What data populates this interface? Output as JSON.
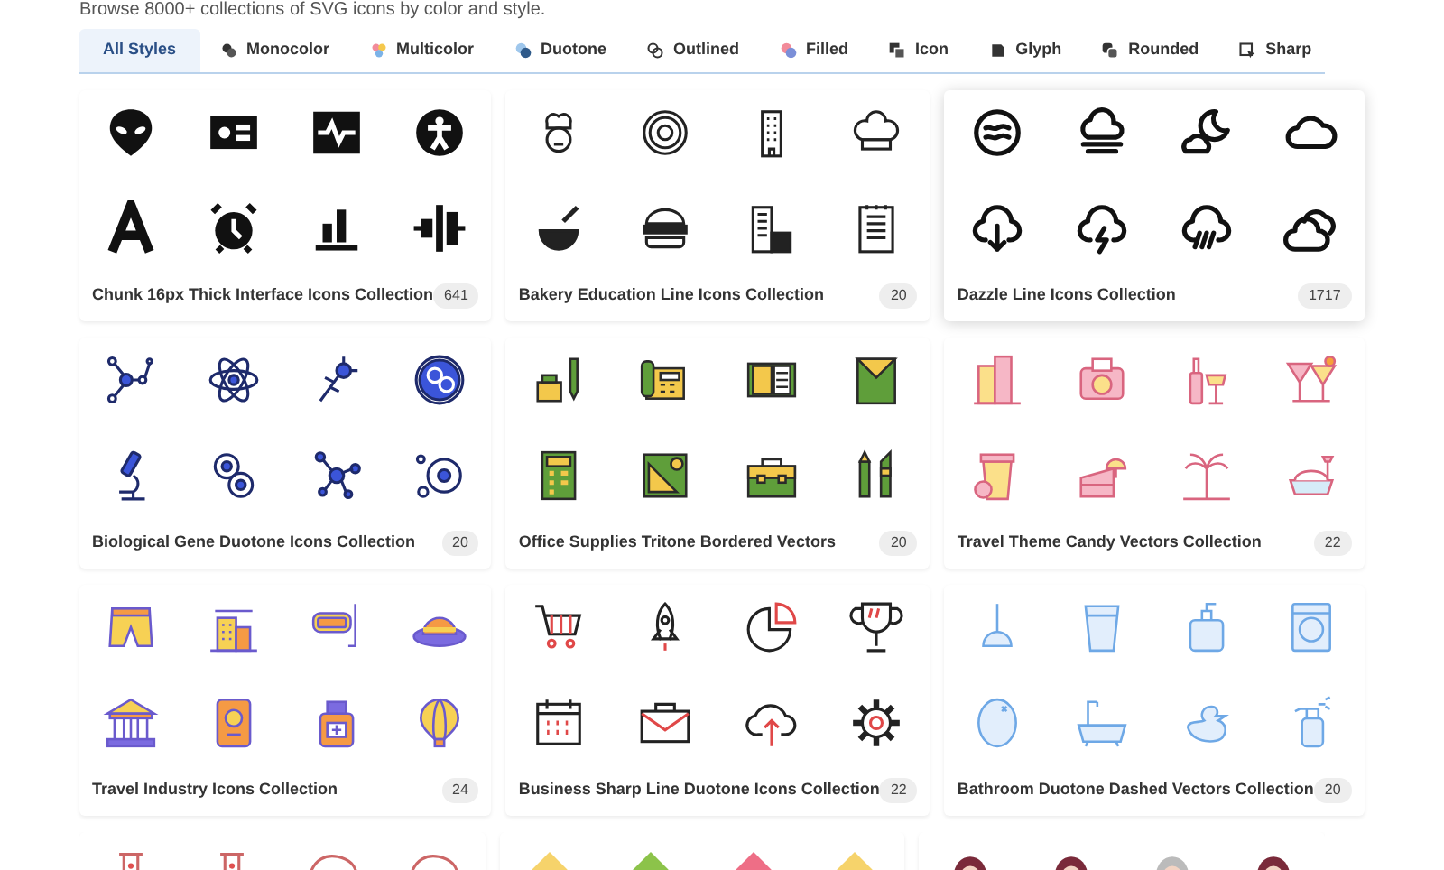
{
  "intro": "Browse 8000+ collections of SVG icons by color and style.",
  "tabs": [
    {
      "label": "All Styles",
      "kind": "all",
      "selected": true
    },
    {
      "label": "Monocolor",
      "kind": "monocolor",
      "selected": false
    },
    {
      "label": "Multicolor",
      "kind": "multicolor",
      "selected": false
    },
    {
      "label": "Duotone",
      "kind": "duotone",
      "selected": false
    },
    {
      "label": "Outlined",
      "kind": "outlined",
      "selected": false
    },
    {
      "label": "Filled",
      "kind": "filled",
      "selected": false
    },
    {
      "label": "Icon",
      "kind": "icon",
      "selected": false
    },
    {
      "label": "Glyph",
      "kind": "glyph",
      "selected": false
    },
    {
      "label": "Rounded",
      "kind": "rounded",
      "selected": false
    },
    {
      "label": "Sharp",
      "kind": "sharp",
      "selected": false
    }
  ],
  "collections": [
    {
      "title": "Chunk 16px Thick Interface Icons Collection",
      "count": "641",
      "kind": "interface",
      "hovered": false
    },
    {
      "title": "Bakery Education Line Icons Collection",
      "count": "20",
      "kind": "bakery",
      "hovered": false
    },
    {
      "title": "Dazzle Line Icons Collection",
      "count": "1717",
      "kind": "weather",
      "hovered": true
    },
    {
      "title": "Biological Gene Duotone Icons Collection",
      "count": "20",
      "kind": "biology",
      "hovered": false
    },
    {
      "title": "Office Supplies Tritone Bordered Vectors",
      "count": "20",
      "kind": "office",
      "hovered": false
    },
    {
      "title": "Travel Theme Candy Vectors Collection",
      "count": "22",
      "kind": "candy",
      "hovered": false
    },
    {
      "title": "Travel Industry Icons Collection",
      "count": "24",
      "kind": "travel",
      "hovered": false
    },
    {
      "title": "Business Sharp Line Duotone Icons Collection",
      "count": "22",
      "kind": "business",
      "hovered": false
    },
    {
      "title": "Bathroom Duotone Dashed Vectors Collection",
      "count": "20",
      "kind": "bathroom",
      "hovered": false
    }
  ]
}
